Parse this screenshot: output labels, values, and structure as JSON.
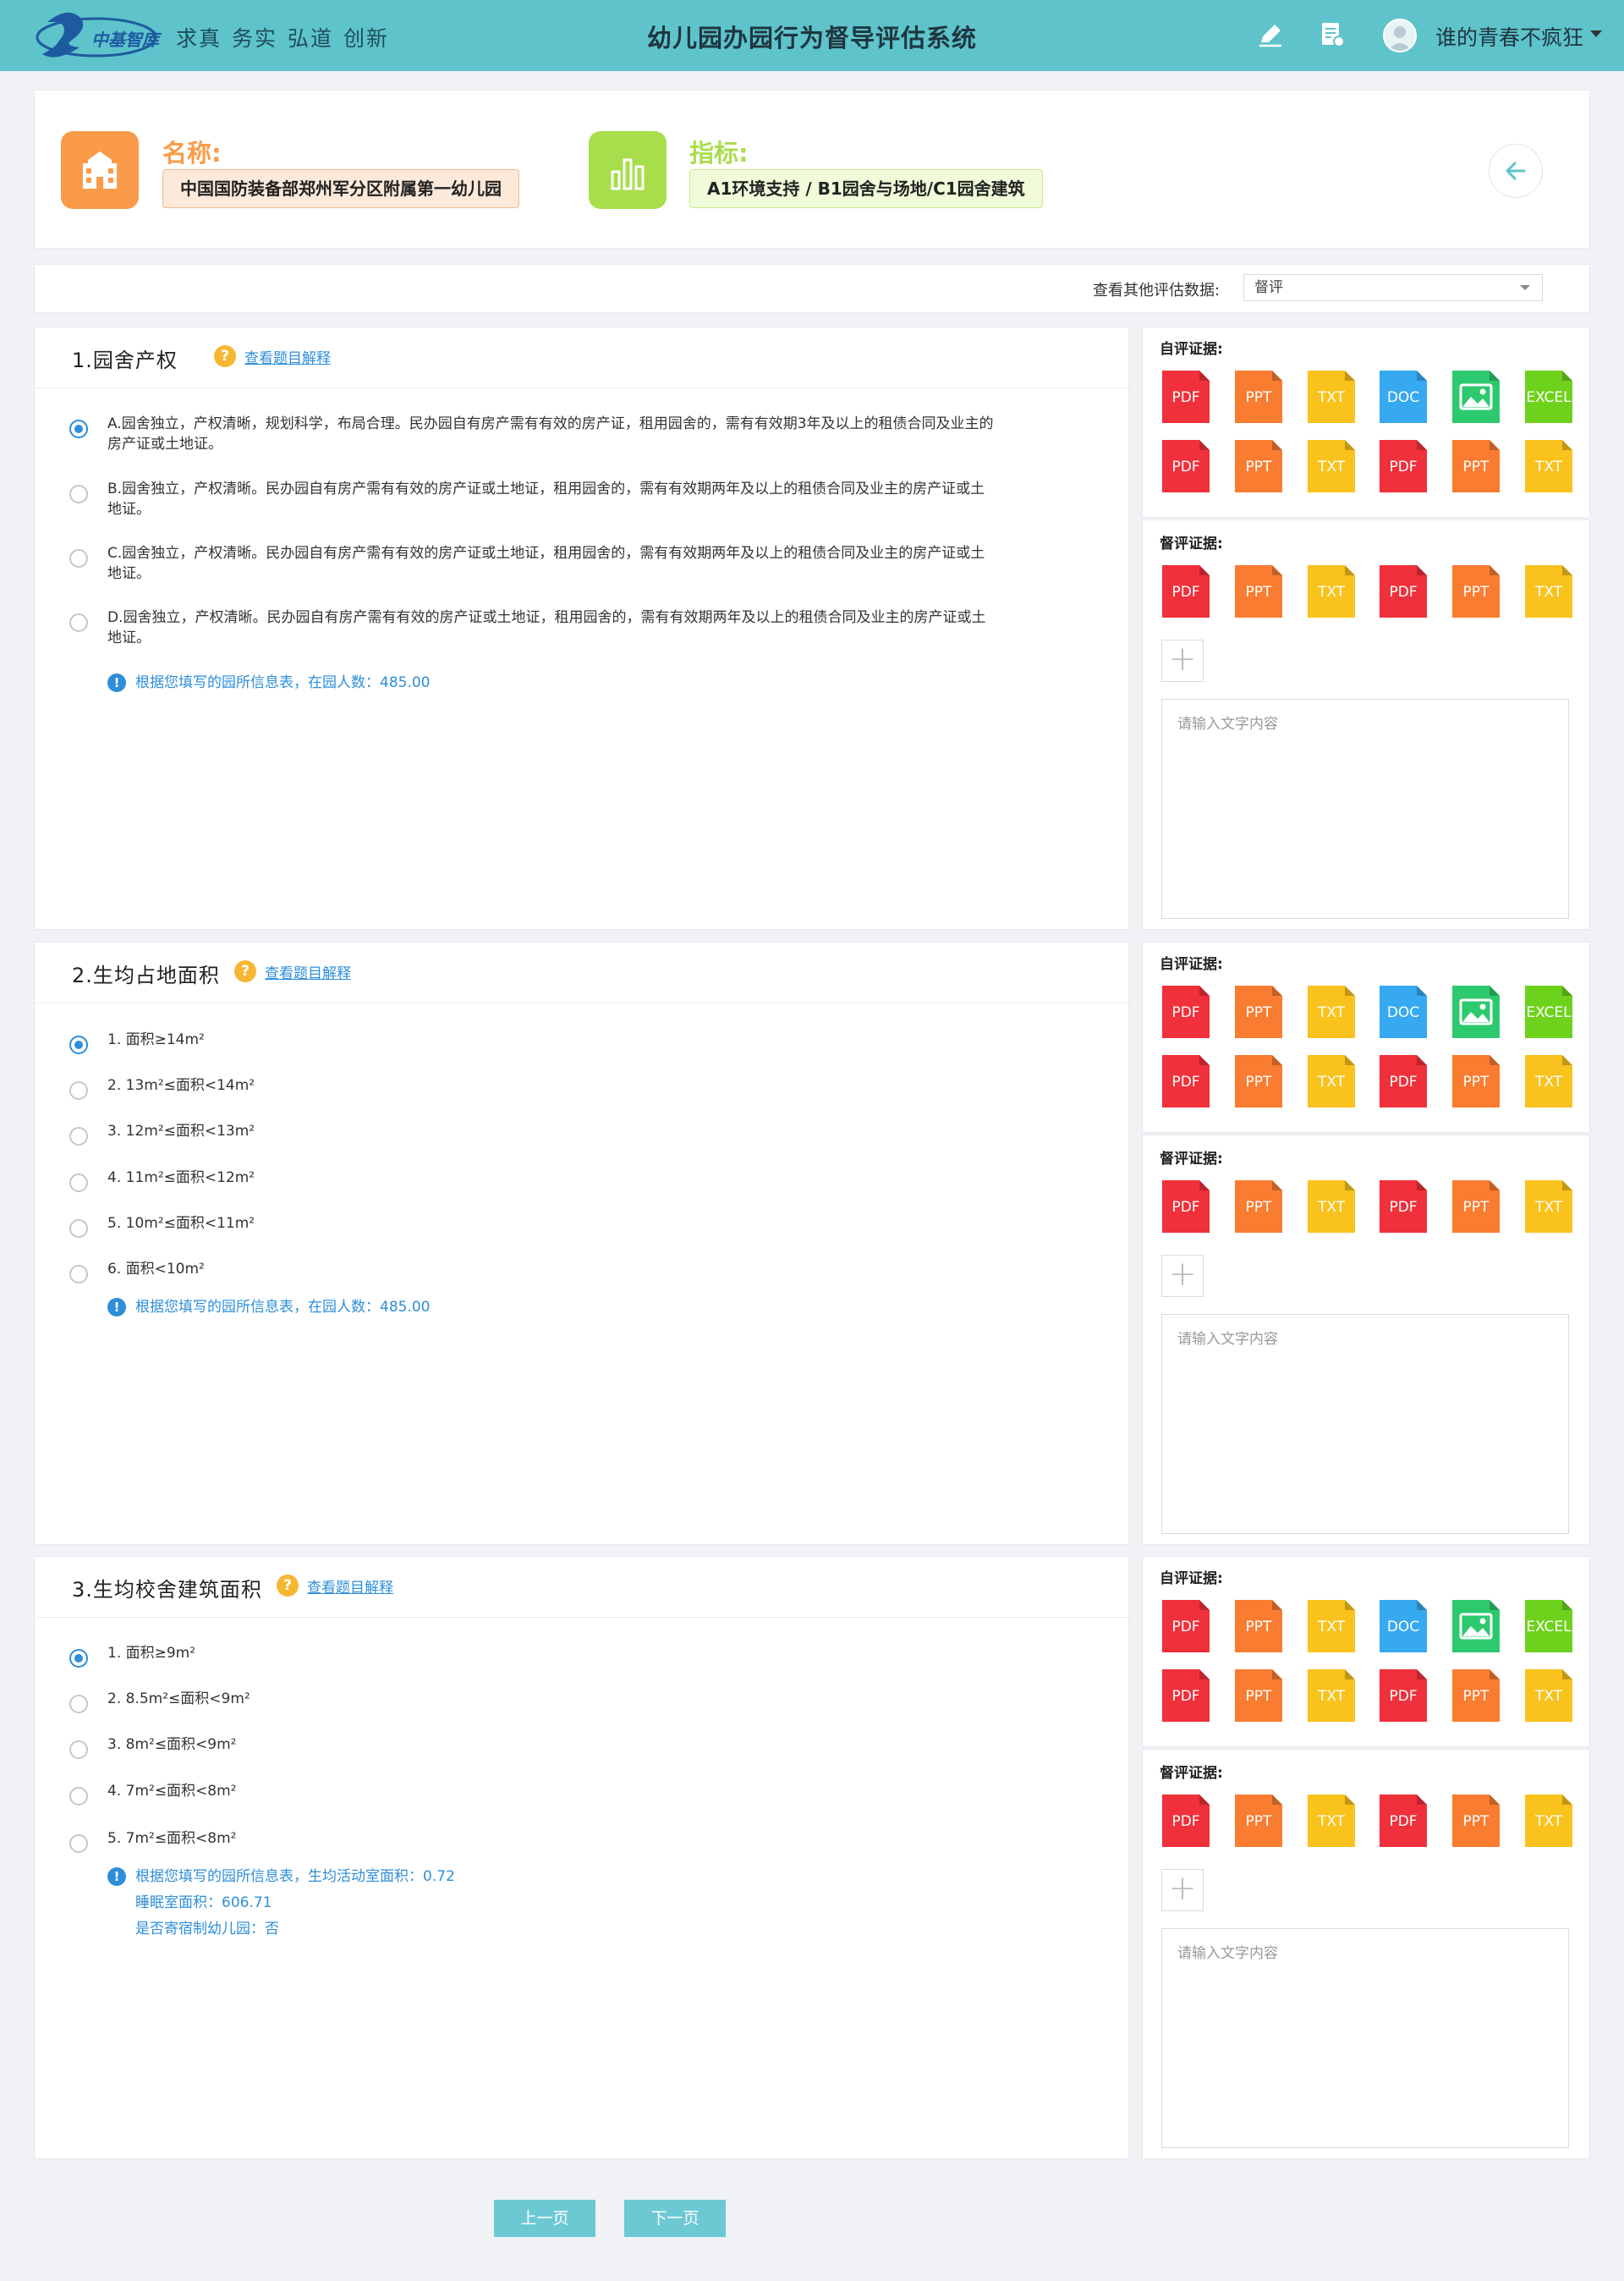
{
  "header": {
    "logo_text": "中基智库",
    "slogan": [
      "求真",
      "务实",
      "弘道",
      "创新"
    ],
    "title": "幼儿园办园行为督导评估系统",
    "user": "谁的青春不疯狂"
  },
  "info": {
    "name_label": "名称:",
    "name_value": "中国国防装备部郑州军分区附属第一幼儿园",
    "index_label": "指标:",
    "index_value": "A1环境支持 / B1园舍与场地/C1园舍建筑"
  },
  "filter": {
    "label": "查看其他评估数据:",
    "selected": "督评"
  },
  "questions": [
    {
      "title": "1.园舍产权",
      "help": "查看题目解释",
      "options": [
        {
          "l1": "A.园舍独立，产权清晰，规划科学，布局合理。民办园自有房产需有有效的房产证，租用园舍的，需有有效期3年及以上的租债合同及业主的",
          "l2": "房产证或土地证。",
          "checked": true
        },
        {
          "l1": "B.园舍独立，产权清晰。民办园自有房产需有有效的房产证或土地证，租用园舍的，需有有效期两年及以上的租债合同及业主的房产证或土",
          "l2": "地证。",
          "checked": false
        },
        {
          "l1": "C.园舍独立，产权清晰。民办园自有房产需有有效的房产证或土地证，租用园舍的，需有有效期两年及以上的租债合同及业主的房产证或土",
          "l2": "地证。",
          "checked": false
        },
        {
          "l1": "D.园舍独立，产权清晰。民办园自有房产需有有效的房产证或土地证，租用园舍的，需有有效期两年及以上的租债合同及业主的房产证或土",
          "l2": "地证。",
          "checked": false
        }
      ],
      "notes": [
        "根据您填写的园所信息表，在园人数：485.00"
      ]
    },
    {
      "title": "2.生均占地面积",
      "help": "查看题目解释",
      "options": [
        {
          "l1": "1. 面积≥14m²",
          "checked": true
        },
        {
          "l1": "2. 13m²≤面积<14m²",
          "checked": false
        },
        {
          "l1": "3. 12m²≤面积<13m²",
          "checked": false
        },
        {
          "l1": "4. 11m²≤面积<12m²",
          "checked": false
        },
        {
          "l1": "5. 10m²≤面积<11m²",
          "checked": false
        },
        {
          "l1": "6. 面积<10m²",
          "checked": false
        }
      ],
      "notes": [
        "根据您填写的园所信息表，在园人数：485.00"
      ]
    },
    {
      "title": "3.生均校舍建筑面积",
      "help": "查看题目解释",
      "options": [
        {
          "l1": "1. 面积≥9m²",
          "checked": true
        },
        {
          "l1": "2. 8.5m²≤面积<9m²",
          "checked": false
        },
        {
          "l1": "3. 8m²≤面积<9m²",
          "checked": false
        },
        {
          "l1": "4. 7m²≤面积<8m²",
          "checked": false
        },
        {
          "l1": "5. 7m²≤面积<8m²",
          "checked": false
        }
      ],
      "notes": [
        "根据您填写的园所信息表，生均活动室面积：0.72",
        "睡眠室面积：606.71",
        "是否寄宿制幼儿园：否"
      ]
    }
  ],
  "evidence": {
    "self_label": "自评证据:",
    "sup_label": "督评证据:",
    "placeholder": "请输入文字内容",
    "self_files": [
      "PDF",
      "PPT",
      "TXT",
      "DOC",
      "IMAGE",
      "EXCEL",
      "PDF",
      "PPT",
      "TXT",
      "PDF",
      "PPT",
      "TXT"
    ],
    "sup_files": [
      "PDF",
      "PPT",
      "TXT",
      "PDF",
      "PPT",
      "TXT"
    ]
  },
  "file_colors": {
    "PDF": "#f0303a",
    "PPT": "#f97c30",
    "TXT": "#f9c21c",
    "DOC": "#36a9f0",
    "IMAGE": "#2dc96e",
    "EXCEL": "#6ed21d"
  },
  "pager": {
    "prev": "上一页",
    "next": "下一页"
  }
}
